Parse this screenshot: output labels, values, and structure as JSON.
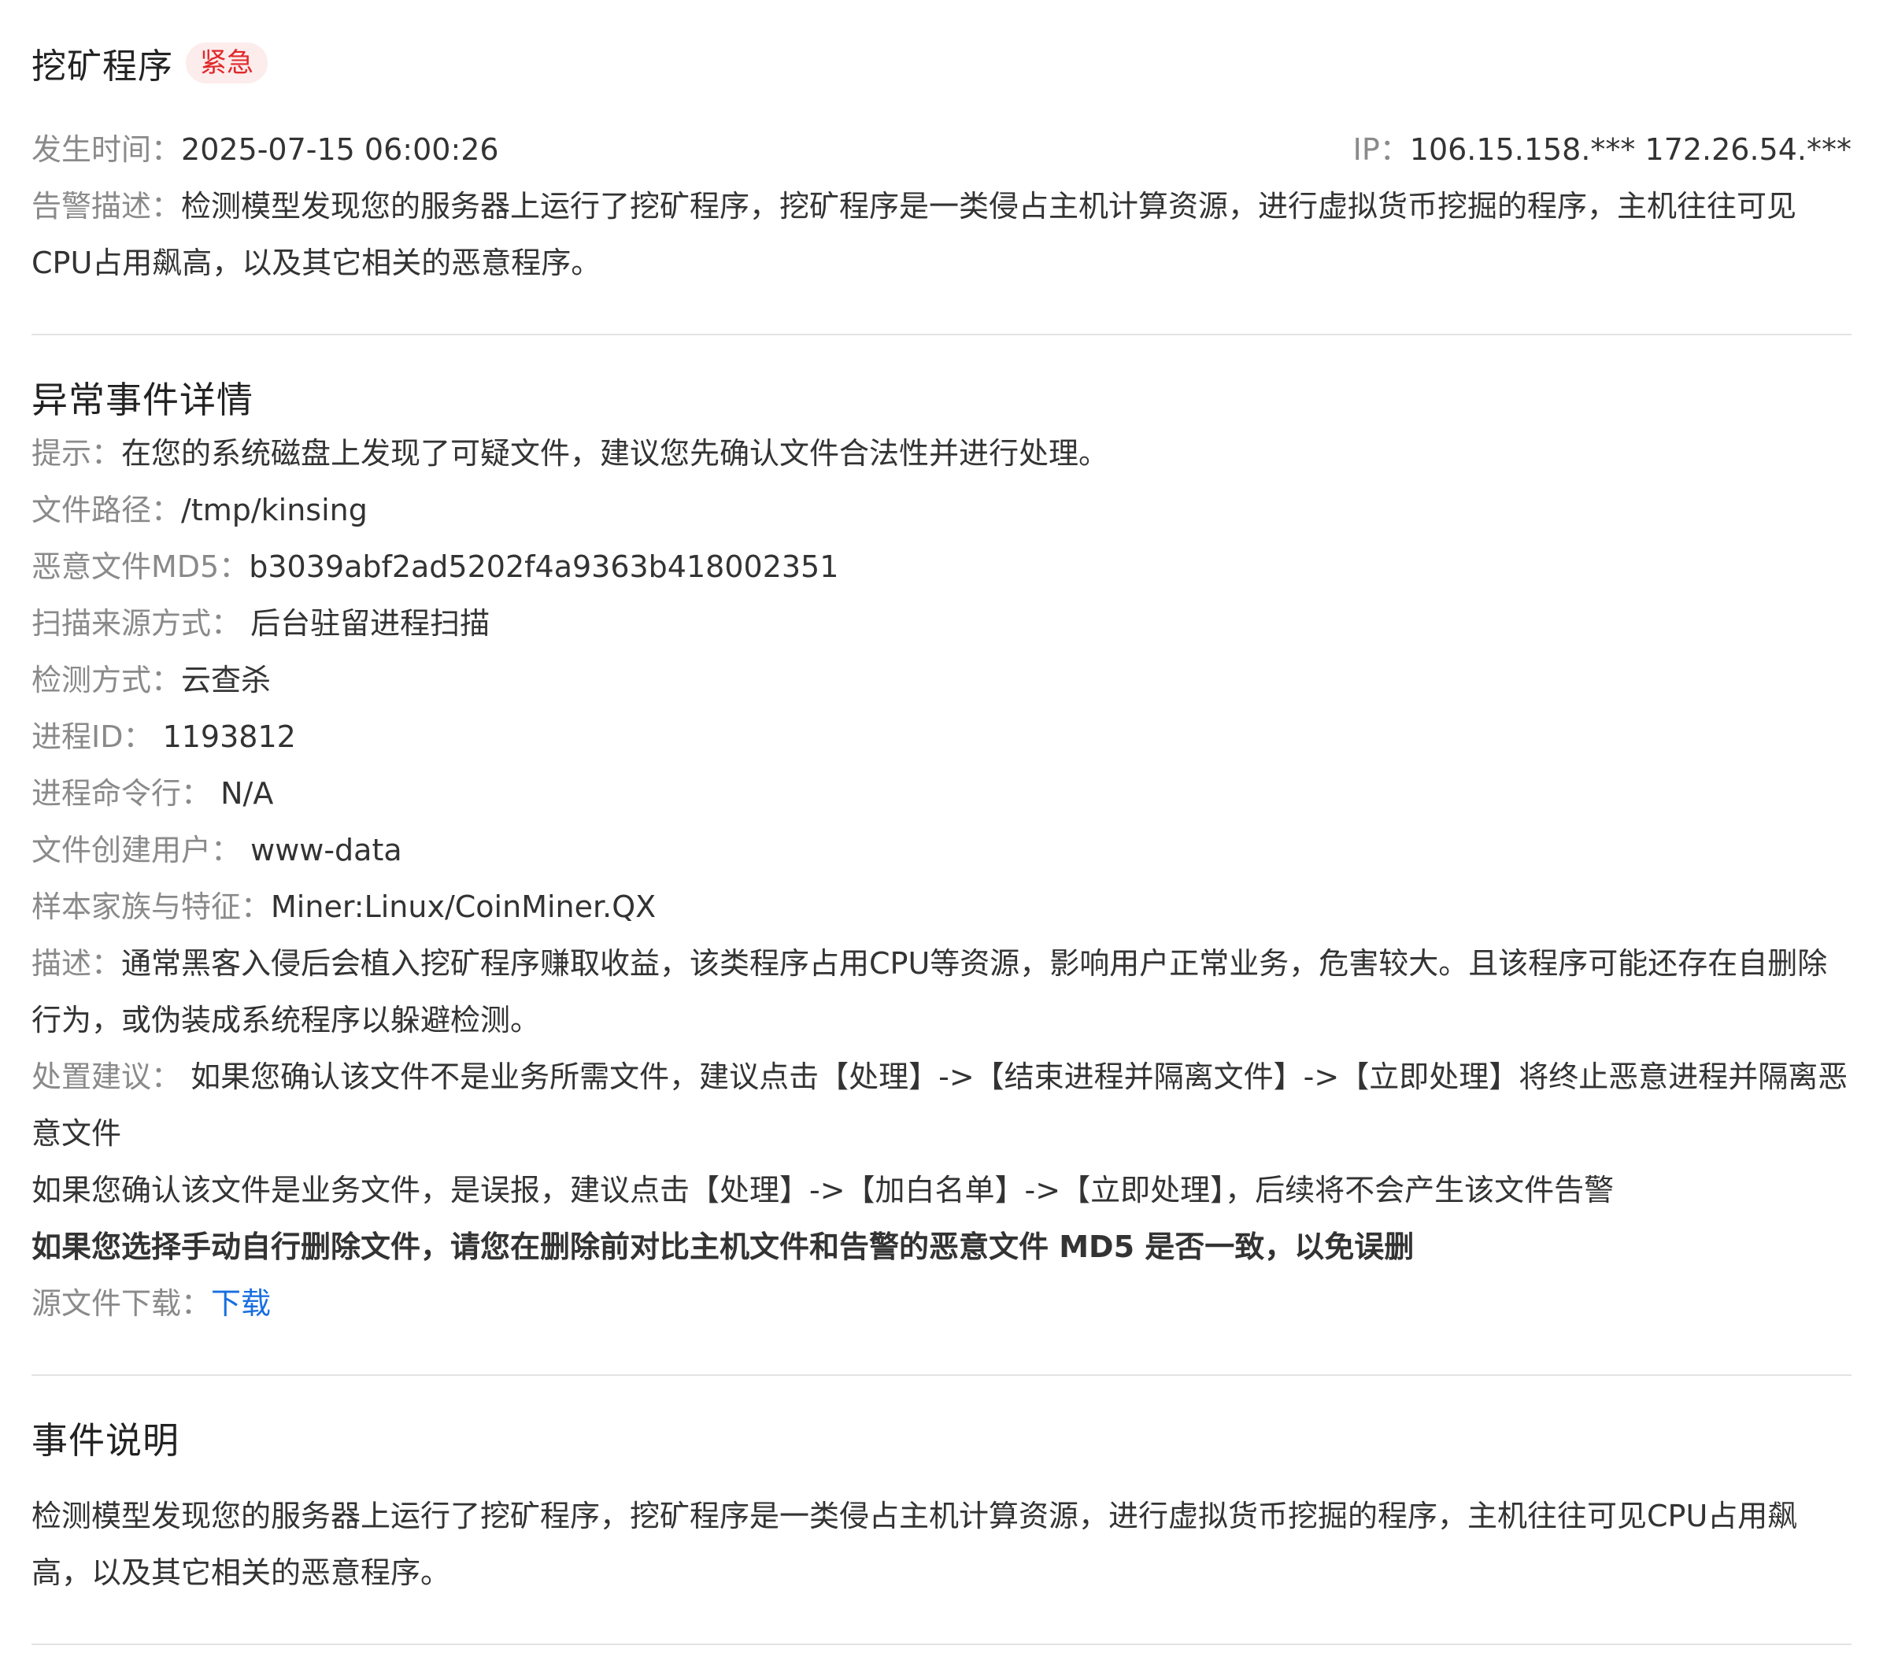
{
  "header": {
    "title": "挖矿程序",
    "badge": "紧急"
  },
  "meta": {
    "time_label": "发生时间：",
    "time_value": "2025-07-15 06:00:26",
    "ip_label": "IP：",
    "ip_value": "106.15.158.*** 172.26.54.***",
    "desc_label": "告警描述：",
    "desc_value": "检测模型发现您的服务器上运行了挖矿程序，挖矿程序是一类侵占主机计算资源，进行虚拟货币挖掘的程序，主机往往可见CPU占用飙高，以及其它相关的恶意程序。"
  },
  "details": {
    "title": "异常事件详情",
    "tip_label": "提示：",
    "tip_value": "在您的系统磁盘上发现了可疑文件，建议您先确认文件合法性并进行处理。",
    "path_label": "文件路径：",
    "path_value": "/tmp/kinsing",
    "md5_label": "恶意文件MD5：",
    "md5_value": "b3039abf2ad5202f4a9363b418002351",
    "scan_label": "扫描来源方式：",
    "scan_value": "后台驻留进程扫描",
    "detect_label": "检测方式：",
    "detect_value": "云查杀",
    "pid_label": "进程ID：",
    "pid_value": "1193812",
    "cmd_label": "进程命令行：",
    "cmd_value": "N/A",
    "user_label": "文件创建用户：",
    "user_value": "www-data",
    "family_label": "样本家族与特征：",
    "family_value": "Miner:Linux/CoinMiner.QX",
    "description_label": "描述：",
    "description_value": "通常黑客入侵后会植入挖矿程序赚取收益，该类程序占用CPU等资源，影响用户正常业务，危害较大。且该程序可能还存在自删除行为，或伪装成系统程序以躲避检测。",
    "advice_label": "处置建议：",
    "advice_value": "如果您确认该文件不是业务所需文件，建议点击【处理】->【结束进程并隔离文件】->【立即处理】将终止恶意进程并隔离恶意文件",
    "advice_line2": "如果您确认该文件是业务文件，是误报，建议点击【处理】->【加白名单】->【立即处理】，后续将不会产生该文件告警",
    "advice_bold": "如果您选择手动自行删除文件，请您在删除前对比主机文件和告警的恶意文件 MD5 是否一致，以免误删",
    "download_label": "源文件下载：",
    "download_link": "下载"
  },
  "explanation": {
    "title": "事件说明",
    "text": "检测模型发现您的服务器上运行了挖矿程序，挖矿程序是一类侵占主机计算资源，进行虚拟货币挖掘的程序，主机往往可见CPU占用飙高，以及其它相关的恶意程序。"
  }
}
